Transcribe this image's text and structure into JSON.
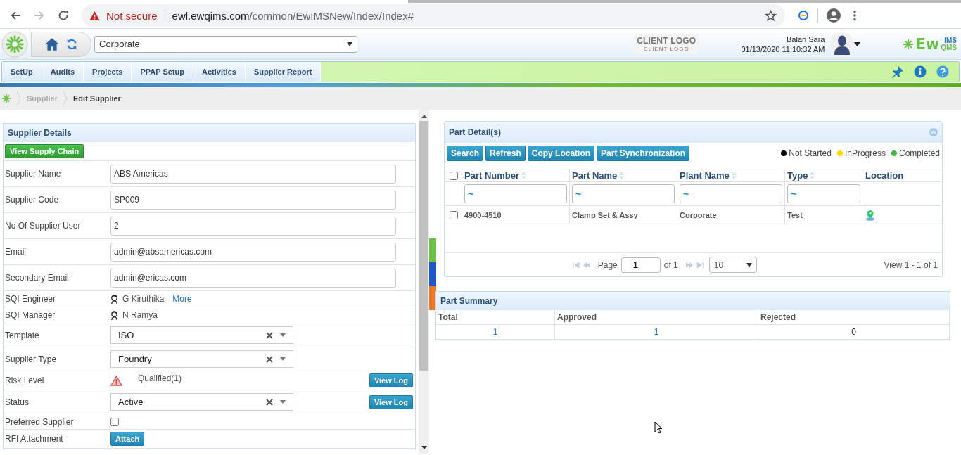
{
  "browser": {
    "security": "Not secure",
    "url_host": "ewl.ewqims.com",
    "url_path": "/common/EwIMSNew/Index/Index#"
  },
  "header": {
    "plant_select": "Corporate",
    "client_logo": "CLIENT LOGO",
    "client_logo_sub": "CLIENT LOGO",
    "user_name": "Balan Sara",
    "datetime": "01/13/2020 11:10:32 AM",
    "brand": {
      "main": "Ew",
      "top": "IMS",
      "bottom": "QMS"
    }
  },
  "nav": {
    "items": [
      "SetUp",
      "Audits",
      "Projects",
      "PPAP Setup",
      "Activities",
      "Supplier Report"
    ]
  },
  "breadcrumb": [
    {
      "label": "Supplier",
      "current": false
    },
    {
      "label": "Edit Supplier",
      "current": true
    }
  ],
  "supplier_details": {
    "title": "Supplier Details",
    "supply_chain_button": "View Supply Chain",
    "fields": [
      {
        "kind": "input",
        "label": "Supplier Name",
        "value": "ABS Americas"
      },
      {
        "kind": "input",
        "label": "Supplier Code",
        "value": "SP009"
      },
      {
        "kind": "input",
        "label": "No Of Supplier User",
        "value": "2"
      },
      {
        "kind": "input",
        "label": "Email",
        "value": "admin@absamericas.com"
      },
      {
        "kind": "input",
        "label": "Secondary Email",
        "value": "admin@ericas.com"
      },
      {
        "kind": "person",
        "label": "SQI Engineer",
        "value": "G Kiruthika",
        "link": "More"
      },
      {
        "kind": "person",
        "label": "SQI Manager",
        "value": "N Ramya"
      },
      {
        "kind": "select",
        "label": "Template",
        "value": "ISO"
      },
      {
        "kind": "select",
        "label": "Supplier Type",
        "value": "Foundry"
      },
      {
        "kind": "risk",
        "label": "Risk Level",
        "value": "Qualified(1)",
        "button": "View Log"
      },
      {
        "kind": "select",
        "label": "Status",
        "value": "Active",
        "button": "View Log"
      },
      {
        "kind": "checkbox",
        "label": "Preferred Supplier",
        "checked": false
      },
      {
        "kind": "attachment",
        "label": "RFI Attachment",
        "button": "Attach"
      }
    ]
  },
  "part_details": {
    "title": "Part Detail(s)",
    "buttons": [
      "Search",
      "Refresh",
      "Copy Location",
      "Part Synchronization"
    ],
    "legend": [
      {
        "label": "Not Started",
        "color": "#000000"
      },
      {
        "label": "InProgress",
        "color": "#ffd700"
      },
      {
        "label": "Completed",
        "color": "#4caf50"
      }
    ],
    "columns": [
      {
        "label": "Part Number",
        "sortable": true
      },
      {
        "label": "Part Name",
        "sortable": true
      },
      {
        "label": "Plant Name",
        "sortable": true
      },
      {
        "label": "Type",
        "sortable": true
      },
      {
        "label": "Location",
        "sortable": false
      }
    ],
    "all_checked": false,
    "filters": [
      "~",
      "~",
      "~",
      "~"
    ],
    "rows": [
      {
        "checked": false,
        "cells": [
          "4900-4510",
          "Clamp Set & Assy",
          "Corporate",
          "Test"
        ]
      }
    ],
    "pager": {
      "page_label": "Page",
      "page": "1",
      "of": "of 1",
      "page_size": "10",
      "view": "View 1 - 1 of 1"
    }
  },
  "part_summary": {
    "title": "Part Summary",
    "columns": [
      "Total",
      "Approved",
      "Rejected"
    ],
    "values": [
      "1",
      "1",
      "0"
    ]
  }
}
